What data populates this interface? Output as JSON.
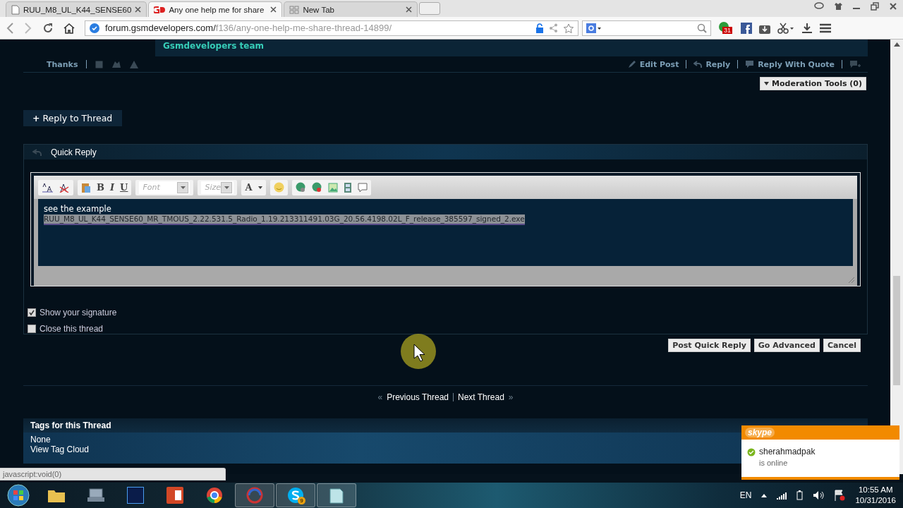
{
  "browser": {
    "tabs": [
      {
        "title": "RUU_M8_UL_K44_SENSE60",
        "selected": false
      },
      {
        "title": "Any one help me for share",
        "selected": true
      },
      {
        "title": "New Tab",
        "selected": false
      }
    ],
    "address": {
      "host": "forum.gsmdevelopers.com/",
      "path": "f136/any-one-help-me-share-thread-14899/"
    },
    "extension_badge": "31"
  },
  "post": {
    "signature": "Gsmdevelopers team",
    "left_actions": [
      "Thanks"
    ],
    "right_actions": [
      "Edit Post",
      "Reply",
      "Reply With Quote"
    ],
    "moderation_tools": "Moderation Tools (0)"
  },
  "reply_to_thread": {
    "icon": "+",
    "label": "Reply to Thread"
  },
  "quick_reply": {
    "title": "Quick Reply",
    "format_buttons": [
      "B",
      "I",
      "U"
    ],
    "font_select": "Font",
    "size_select": "Size",
    "color_button": "A",
    "lines": [
      {
        "text": "see the example",
        "selected": false
      },
      {
        "text": "RUU_M8_UL_K44_SENSE60_MR_TMOUS_2.22.531.5_Radio_1.19.213311491.03G_20.56.4198.02L_F_release_385597_signed_2.exe",
        "selected": true
      }
    ],
    "options": [
      {
        "label": "Show your signature",
        "checked": true
      },
      {
        "label": "Close this thread",
        "checked": false
      }
    ],
    "buttons": [
      "Post Quick Reply",
      "Go Advanced",
      "Cancel"
    ]
  },
  "thread_nav": {
    "previous": {
      "arrow": "«",
      "label": "Previous Thread"
    },
    "next": {
      "label": "Next Thread",
      "arrow": "»"
    }
  },
  "tags": {
    "title": "Tags for this Thread",
    "lines": [
      "None",
      "View Tag Cloud"
    ]
  },
  "status_bubble": "javascript:void(0)",
  "skype": {
    "logo": "skype",
    "user": "sherahmadpak",
    "status": "is online"
  },
  "taskbar": {
    "skype_badge": "9",
    "language": "EN",
    "time": "10:55 AM",
    "date": "10/31/2016"
  }
}
